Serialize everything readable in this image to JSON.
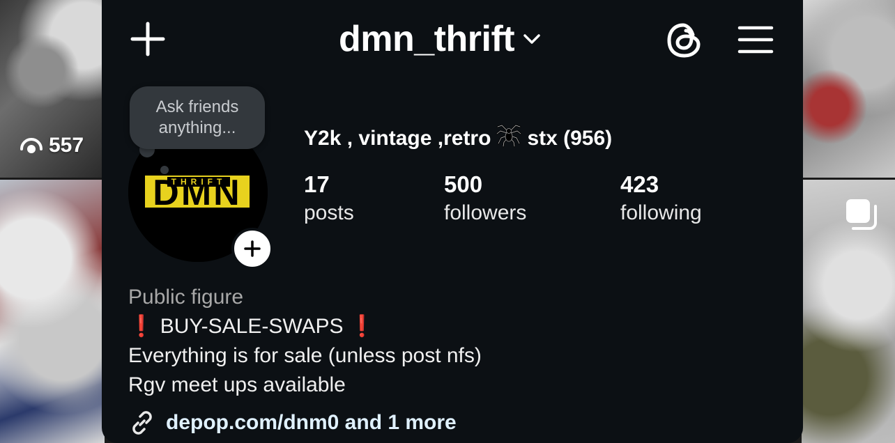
{
  "background": {
    "left_top_view_count": "557"
  },
  "header": {
    "username": "dmn_thrift"
  },
  "note": {
    "text": "Ask friends anything..."
  },
  "avatar": {
    "logo_main": "DMN",
    "logo_sub": "THRIFT",
    "logo_color": "#e8d21e"
  },
  "profile": {
    "name_part1": "Y2k , vintage ,retro",
    "name_part2": "stx (956)"
  },
  "stats": {
    "posts_count": "17",
    "posts_label": "posts",
    "followers_count": "500",
    "followers_label": "followers",
    "following_count": "423",
    "following_label": "following"
  },
  "bio": {
    "category": "Public figure",
    "line1_text": "BUY-SALE-SWAPS",
    "line1_mark": "❗",
    "line2": "Everything is for sale (unless post nfs)",
    "line3": "Rgv meet ups available"
  },
  "link": {
    "text": "depop.com/dnm0 and 1 more"
  },
  "colors": {
    "card_bg": "#0c1014",
    "note_bg": "#33383d",
    "link_color": "#e0f1ff",
    "category_color": "#a8a8a8",
    "accent_red": "#e0202a"
  }
}
